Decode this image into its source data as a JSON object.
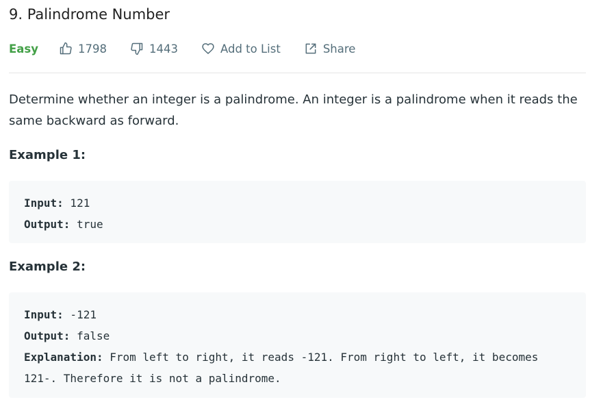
{
  "problem": {
    "title": "9. Palindrome Number",
    "difficulty": "Easy",
    "likes": "1798",
    "dislikes": "1443",
    "add_to_list_label": "Add to List",
    "share_label": "Share",
    "description": "Determine whether an integer is a palindrome. An integer is a palindrome when it reads the same backward as forward."
  },
  "examples": [
    {
      "heading": "Example 1:",
      "input_key": "Input:",
      "input_value": " 121",
      "output_key": "Output:",
      "output_value": " true"
    },
    {
      "heading": "Example 2:",
      "input_key": "Input:",
      "input_value": " -121",
      "output_key": "Output:",
      "output_value": " false",
      "explanation_key": "Explanation:",
      "explanation_value": " From left to right, it reads -121. From right to left, it becomes 121-. Therefore it is not a palindrome."
    }
  ],
  "icons": {
    "like": "thumbs-up-icon",
    "dislike": "thumbs-down-icon",
    "favorite": "heart-icon",
    "share": "share-icon"
  },
  "colors": {
    "easy": "#43a047",
    "meta_text": "#546e7a",
    "example_bg": "#f7f9fa"
  }
}
